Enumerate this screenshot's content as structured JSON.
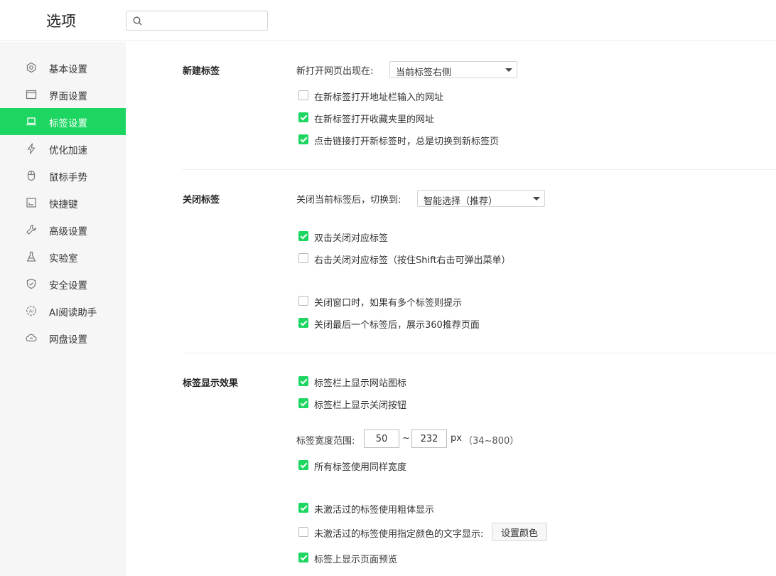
{
  "header": {
    "title": "选项",
    "search": {
      "value": "",
      "placeholder": ""
    }
  },
  "sidebar": {
    "items": [
      {
        "label": "基本设置",
        "icon": "gear-icon"
      },
      {
        "label": "界面设置",
        "icon": "window-icon"
      },
      {
        "label": "标签设置",
        "icon": "laptop-icon",
        "active": true
      },
      {
        "label": "优化加速",
        "icon": "lightning-icon"
      },
      {
        "label": "鼠标手势",
        "icon": "mouse-icon"
      },
      {
        "label": "快捷键",
        "icon": "keyboard-icon"
      },
      {
        "label": "高级设置",
        "icon": "wrench-icon"
      },
      {
        "label": "实验室",
        "icon": "flask-icon"
      },
      {
        "label": "安全设置",
        "icon": "shield-icon"
      },
      {
        "label": "AI阅读助手",
        "icon": "ai-icon"
      },
      {
        "label": "网盘设置",
        "icon": "cloud-icon"
      }
    ]
  },
  "sections": {
    "new_tab": {
      "title": "新建标签",
      "open_position_label": "新打开网页出现在:",
      "open_position_value": "当前标签右侧",
      "options": [
        {
          "label": "在新标签打开地址栏输入的网址",
          "checked": false
        },
        {
          "label": "在新标签打开收藏夹里的网址",
          "checked": true
        },
        {
          "label": "点击链接打开新标签时，总是切换到新标签页",
          "checked": true
        }
      ]
    },
    "close_tab": {
      "title": "关闭标签",
      "switch_to_label": "关闭当前标签后，切换到:",
      "switch_to_value": "智能选择（推荐）",
      "options": [
        {
          "label": "双击关闭对应标签",
          "checked": true
        },
        {
          "label": "右击关闭对应标签（按住Shift右击可弹出菜单）",
          "checked": false
        },
        {
          "label": "关闭窗口时，如果有多个标签则提示",
          "checked": false
        },
        {
          "label": "关闭最后一个标签后，展示360推荐页面",
          "checked": true
        }
      ]
    },
    "display": {
      "title": "标签显示效果",
      "options_top": [
        {
          "label": "标签栏上显示网站图标",
          "checked": true
        },
        {
          "label": "标签栏上显示关闭按钮",
          "checked": true
        }
      ],
      "width_label": "标签宽度范围:",
      "width_min": "50",
      "width_sep": "~",
      "width_max": "232",
      "width_unit": "px",
      "width_hint": "（34~800）",
      "same_width": {
        "label": "所有标签使用同样宽度",
        "checked": true
      },
      "inactive_bold": {
        "label": "未激活过的标签使用粗体显示",
        "checked": true
      },
      "inactive_color": {
        "label": "未激活过的标签使用指定颜色的文字显示:",
        "checked": false
      },
      "set_color_button": "设置颜色",
      "page_preview": {
        "label": "标签上显示页面预览",
        "checked": true
      }
    }
  },
  "colors": {
    "accent": "#1dd661",
    "sidebar_bg": "#f6f6f6"
  }
}
